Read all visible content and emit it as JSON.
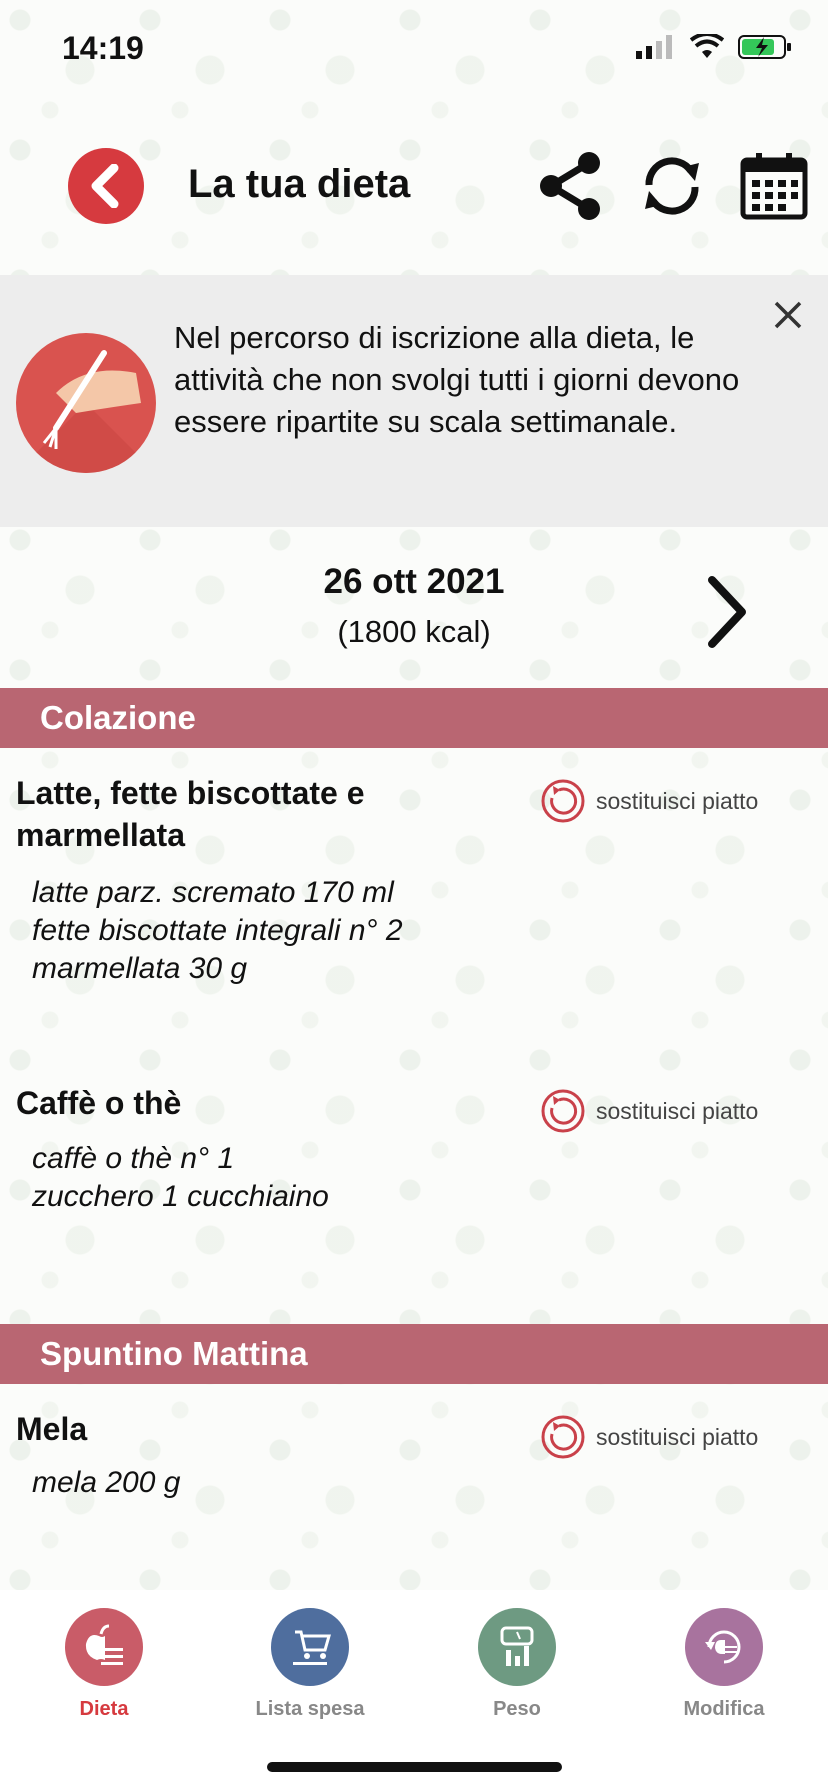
{
  "status_bar": {
    "time": "14:19"
  },
  "header": {
    "title": "La tua dieta",
    "icons": [
      "back-icon",
      "share-icon",
      "refresh-icon",
      "calendar-icon"
    ]
  },
  "banner": {
    "message": "Nel percorso di iscrizione alla dieta, le attività che non svolgi tutti i giorni devono essere ripartite su scala settimanale."
  },
  "date": {
    "day": "26 ott 2021",
    "kcal": "(1800 kcal)"
  },
  "sections": [
    {
      "title": "Colazione",
      "meals": [
        {
          "name": "Latte, fette biscottate e marmellata",
          "details": [
            "latte parz. scremato 170 ml",
            "fette biscottate integrali n° 2",
            "marmellata 30 g"
          ],
          "replace_label": "sostituisci piatto"
        },
        {
          "name": "Caffè o thè",
          "details": [
            "caffè o thè n° 1",
            "zucchero 1 cucchiaino"
          ],
          "replace_label": "sostituisci piatto"
        }
      ]
    },
    {
      "title": "Spuntino Mattina",
      "meals": [
        {
          "name": "Mela",
          "details": [
            "mela 200 g"
          ],
          "replace_label": "sostituisci piatto"
        }
      ]
    }
  ],
  "tab_bar": {
    "tabs": [
      {
        "label": "Dieta",
        "color": "#c95c68",
        "active": true
      },
      {
        "label": "Lista spesa",
        "color": "#4f6e9e",
        "active": false
      },
      {
        "label": "Peso",
        "color": "#6e9a82",
        "active": false
      },
      {
        "label": "Modifica",
        "color": "#a8739e",
        "active": false
      }
    ]
  },
  "colors": {
    "accent": "#d63a3f",
    "section": "#b96672"
  }
}
